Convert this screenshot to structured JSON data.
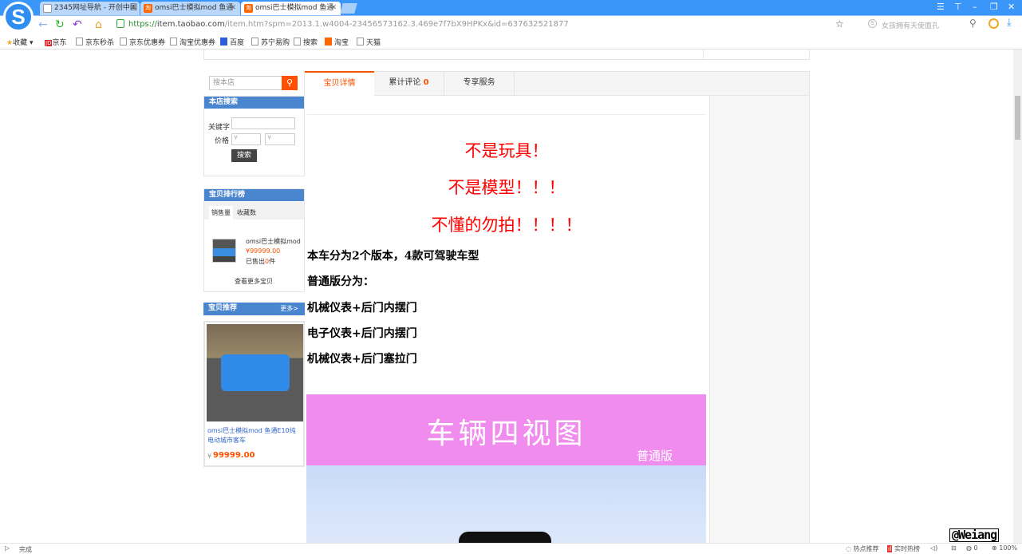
{
  "browser": {
    "tabs": [
      {
        "label": "2345网址导航 - 开创中国",
        "icon": "doc"
      },
      {
        "label": "omsi巴士模拟mod 鱼通",
        "icon": "taobao"
      },
      {
        "label": "omsi巴士模拟mod 鱼通",
        "icon": "taobao",
        "active": true
      }
    ],
    "url_prefix": "https://",
    "url_host": "item.taobao.com",
    "url_path": "/item.htm?spm=2013.1.w4004-23456573162.3.469e7f7bX9HPKx&id=637632521877",
    "search_placeholder": "女孩拥有天使面孔",
    "bookmarks": [
      "收藏",
      "京东",
      "京东秒杀",
      "京东优惠券",
      "淘宝优惠券",
      "百度",
      "苏宁易购",
      "搜索",
      "淘宝",
      "天猫"
    ],
    "status_text": "完成",
    "status_items": {
      "hot": "热点推荐",
      "realtime": "实时热榜",
      "count": "0",
      "zoom": "100%"
    },
    "watermark": "@Weiang"
  },
  "sidebar": {
    "search_placeholder": "搜本店",
    "shop_search": {
      "title": "本店搜索",
      "keyword_label": "关键字",
      "price_label": "价格",
      "price_min_ph": "¥",
      "price_max_ph": "¥",
      "button": "搜索"
    },
    "ranking": {
      "title": "宝贝排行榜",
      "tabs": [
        "销售量",
        "收藏数"
      ],
      "item": {
        "name": "omsi巴士模拟mod",
        "price": "¥99999.00",
        "sold_prefix": "已售出",
        "sold_count": "0",
        "sold_suffix": "件"
      },
      "more": "查看更多宝贝"
    },
    "recommend": {
      "title": "宝贝推荐",
      "more": "更多>",
      "item": {
        "name": "omsi巴士模拟mod 鱼通E10纯电动城市客车",
        "currency": "¥",
        "price": "99999.00"
      }
    }
  },
  "main": {
    "tabs": [
      {
        "label": "宝贝详情"
      },
      {
        "label": "累计评论",
        "count": "0"
      },
      {
        "label": "专享服务"
      }
    ],
    "red_lines": [
      "不是玩具！",
      "不是模型！！！",
      "不懂的勿拍！！！！"
    ],
    "lines": [
      "本车分为2个版本，4款可驾驶车型",
      "普通版分为：",
      "机械仪表+后门内摆门",
      "电子仪表+后门内摆门",
      "机械仪表+后门塞拉门"
    ],
    "banner": {
      "title": "车辆四视图",
      "subtitle": "普通版"
    }
  },
  "colors": {
    "accent": "#ff5000",
    "blue": "#4a86cf",
    "banner": "#f08cee",
    "titlebar": "#3a96f8"
  }
}
